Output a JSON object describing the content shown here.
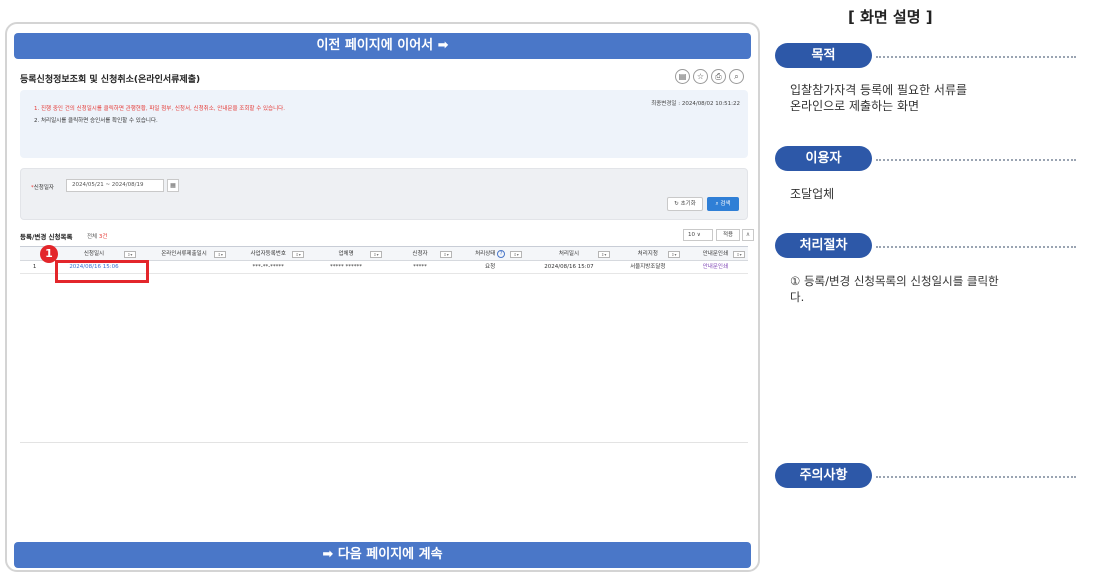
{
  "banners": {
    "top": "이전 페이지에 이어서 ➡",
    "bottom": "➡ 다음 페이지에 계속"
  },
  "screen": {
    "title": "등록신청정보조회 및 신청취소(온라인서류제출)",
    "title_icons": [
      "bookmark-icon",
      "star-icon",
      "print-icon",
      "zoom-icon"
    ],
    "last_modified": "최종변경일 : 2024/08/02 10:51:22",
    "notice_lines": [
      "1. 진행 중인 건의 신청일시를 클릭하면 관행현황, 파일 첨부, 신청서, 신청취소, 안내문을 조회할 수 있습니다.",
      "2. 처리일시를 클릭하면 승인서를 확인할 수 있습니다."
    ],
    "search": {
      "date_label": "신청일자",
      "required_mark": "*",
      "date_value": "2024/05/21 ~ 2024/08/19",
      "reset_label": "↻ 초기화",
      "search_label": "검색"
    },
    "list": {
      "title": "등록/변경 신청목록",
      "count_prefix": "전체",
      "count": "3",
      "count_suffix": "건",
      "page_size": "10",
      "apply_label": "적용"
    },
    "columns": [
      "",
      "신청일시",
      "온라인서류제출일시",
      "사업자등록번호",
      "업체명",
      "신청자",
      "처리상태",
      "처리일시",
      "처리지청",
      "안내문인쇄"
    ],
    "rows": [
      [
        "1",
        "2024/08/16 15:06",
        "",
        "***-**-*****",
        "***** ******",
        "*****",
        "요청",
        "2024/08/16 15:07",
        "서울지방조달청",
        "안내문인쇄"
      ]
    ],
    "marker": "1"
  },
  "panel": {
    "title": "[ 화면 설명 ]",
    "sections": {
      "purpose": {
        "label": "목적",
        "text": "입찰참가자격 등록에 필요한 서류를\n온라인으로 제출하는 화면"
      },
      "user": {
        "label": "이용자",
        "text": "조달업체"
      },
      "procedure": {
        "label": "처리절차",
        "text": "① 등록/변경 신청목록의 신청일시를 클릭한\n   다."
      },
      "caution": {
        "label": "주의사항"
      }
    }
  }
}
